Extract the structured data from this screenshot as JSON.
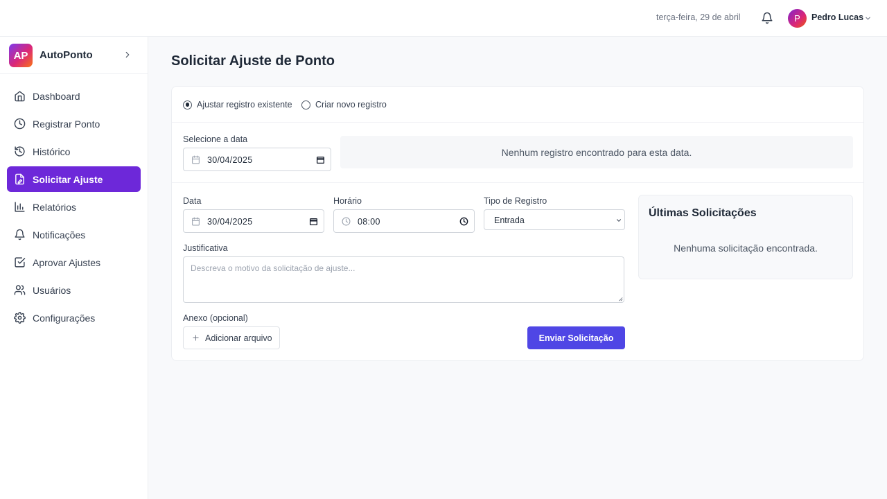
{
  "header": {
    "date": "terça-feira, 29 de abril",
    "user_name": "Pedro Lucas",
    "user_initial": "P",
    "icons": {
      "notifications": "bell-icon",
      "user_menu": "chevron-down-icon"
    }
  },
  "sidebar": {
    "brand_initials": "AP",
    "brand_name": "AutoPonto",
    "items": [
      {
        "label": "Dashboard",
        "icon": "home-icon",
        "active": false
      },
      {
        "label": "Registrar Ponto",
        "icon": "clock-icon",
        "active": false
      },
      {
        "label": "Histórico",
        "icon": "history-icon",
        "active": false
      },
      {
        "label": "Solicitar Ajuste",
        "icon": "file-edit-icon",
        "active": true
      },
      {
        "label": "Relatórios",
        "icon": "bar-chart-icon",
        "active": false
      },
      {
        "label": "Notificações",
        "icon": "bell-icon",
        "active": false
      },
      {
        "label": "Aprovar Ajustes",
        "icon": "check-square-icon",
        "active": false
      },
      {
        "label": "Usuários",
        "icon": "users-icon",
        "active": false
      },
      {
        "label": "Configurações",
        "icon": "gear-icon",
        "active": false
      }
    ]
  },
  "main": {
    "title": "Solicitar Ajuste de Ponto",
    "mode_options": [
      {
        "label": "Ajustar registro existente",
        "selected": true
      },
      {
        "label": "Criar novo registro",
        "selected": false
      }
    ],
    "select_date": {
      "label": "Selecione a data",
      "value": "30/04/2025",
      "no_record_message": "Nenhum registro encontrado para esta data."
    },
    "form": {
      "date_label": "Data",
      "date_value": "30/04/2025",
      "time_label": "Horário",
      "time_value": "08:00",
      "type_label": "Tipo de Registro",
      "type_value": "Entrada",
      "justification_label": "Justificativa",
      "justification_placeholder": "Descreva o motivo da solicitação de ajuste...",
      "attachment_label": "Anexo (opcional)",
      "add_file_label": "Adicionar arquivo",
      "submit_label": "Enviar Solicitação"
    },
    "recent_requests": {
      "title": "Últimas Solicitações",
      "empty_message": "Nenhuma solicitação encontrada."
    }
  },
  "colors": {
    "accent": "#6d28d9",
    "primary_button": "#4f46e5",
    "background": "#f8f9fb"
  }
}
